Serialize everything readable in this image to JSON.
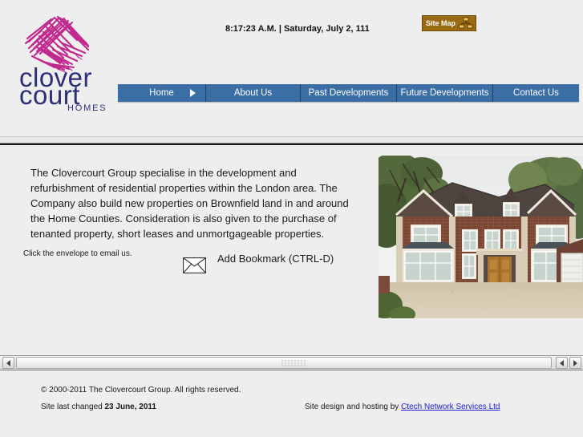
{
  "header": {
    "logo": {
      "line1": "clover",
      "line2": "court",
      "line3": "HOMES",
      "scribble_color": "#bf1f8a",
      "text_color": "#2b2f78"
    },
    "clock": "8:17:23 A.M. | Saturday, July 2, 111",
    "sitemap": {
      "label": "Site Map",
      "icon": "sitemap-icon",
      "background": "#9a6b12",
      "text_color": "#ffffff"
    },
    "nav": {
      "background": "#3a6ea5",
      "items": [
        {
          "label": "Home",
          "has_arrow": true
        },
        {
          "label": "About Us",
          "has_arrow": false
        },
        {
          "label": "Past Developments",
          "has_arrow": false
        },
        {
          "label": "Future Developments",
          "has_arrow": false
        },
        {
          "label": "Contact Us",
          "has_arrow": false
        }
      ]
    }
  },
  "main": {
    "intro": "The Clovercourt Group specialise in the development and refurbishment of residential properties within the London area.  The Company also build new properties on Brownfield land in and around the Home Counties.  Consideration is also given to the purchase of tenanted property, short leases and unmortgageable properties.",
    "email_note": "Click the envelope to email us.",
    "envelope_icon": "envelope-icon",
    "bookmark": "Add Bookmark (CTRL-D)",
    "photo_alt": "Large detached red brick house with gravel driveway and garage"
  },
  "scrollbar": {
    "left_arrow": "scroll-left-icon",
    "right_arrow": "scroll-right-icon",
    "right_arrow_2": "scroll-right-icon"
  },
  "footer": {
    "copyright": "© 2000-2011 The Clovercourt Group. All rights reserved.",
    "lastchanged_prefix": "Site last changed ",
    "lastchanged_date": "23 June, 2011",
    "credit_prefix": "Site design and hosting by ",
    "credit_link": "Ctech Network Services Ltd"
  }
}
